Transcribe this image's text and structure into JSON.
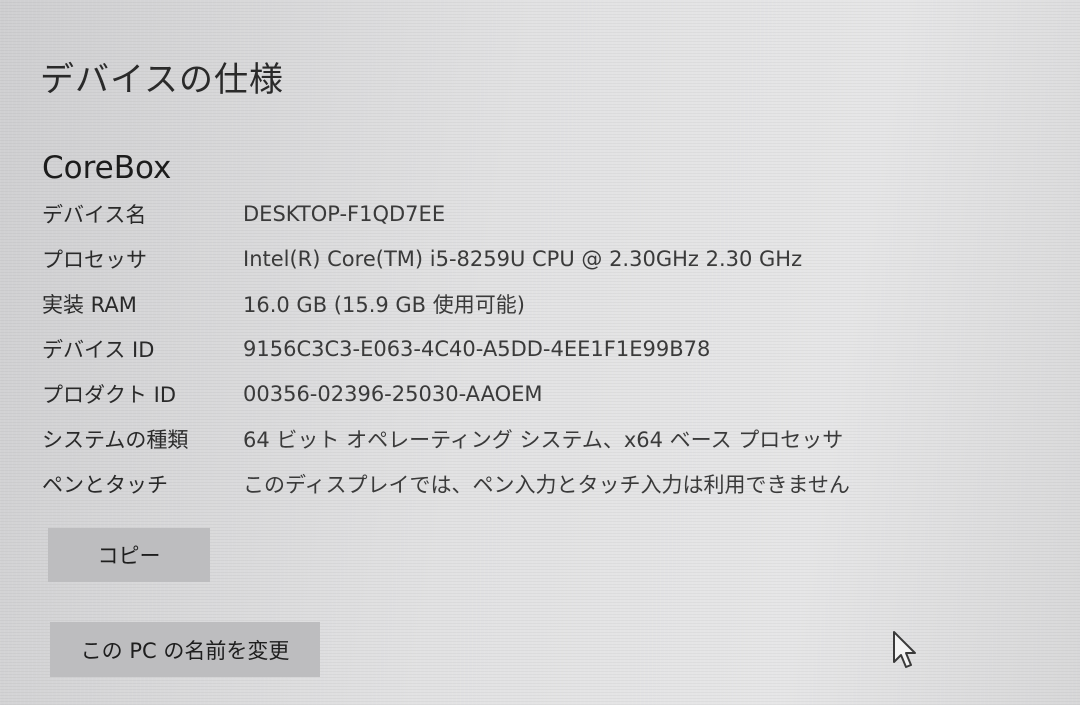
{
  "page": {
    "title": "デバイスの仕様"
  },
  "device": {
    "heading": "CoreBox"
  },
  "specs": [
    {
      "label": "デバイス名",
      "value": "DESKTOP-F1QD7EE"
    },
    {
      "label": "プロセッサ",
      "value": "Intel(R) Core(TM) i5-8259U CPU @ 2.30GHz   2.30 GHz"
    },
    {
      "label": "実装 RAM",
      "value": "16.0 GB (15.9 GB 使用可能)"
    },
    {
      "label": "デバイス ID",
      "value": "9156C3C3-E063-4C40-A5DD-4EE1F1E99B78"
    },
    {
      "label": "プロダクト ID",
      "value": "00356-02396-25030-AAOEM"
    },
    {
      "label": "システムの種類",
      "value": "64 ビット オペレーティング システム、x64 ベース プロセッサ"
    },
    {
      "label": "ペンとタッチ",
      "value": "このディスプレイでは、ペン入力とタッチ入力は利用できません"
    }
  ],
  "buttons": {
    "copy_label": "コピー",
    "rename_label": "この PC の名前を変更"
  },
  "icons": {
    "cursor": "mouse-pointer-icon"
  }
}
